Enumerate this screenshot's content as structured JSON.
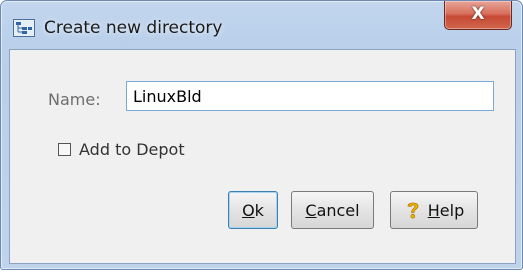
{
  "window": {
    "title": "Create new directory",
    "app_icon": "directory-tree-icon",
    "close_label": "X"
  },
  "form": {
    "name_label": "Name:",
    "name_value": "LinuxBld",
    "checkbox_glyph": "☐",
    "checkbox_label": "Add to Depot",
    "checkbox_checked": false
  },
  "buttons": {
    "ok": {
      "mnemonic": "O",
      "rest": "k"
    },
    "cancel": {
      "mnemonic": "C",
      "rest": "ancel"
    },
    "help": {
      "mnemonic": "H",
      "rest": "elp",
      "icon": "question-mark-icon"
    }
  },
  "colors": {
    "title_bar": "#bfd3ec",
    "close_button": "#c74a33",
    "client_bg": "#f0f0f0",
    "input_border": "#7aa7d6"
  }
}
